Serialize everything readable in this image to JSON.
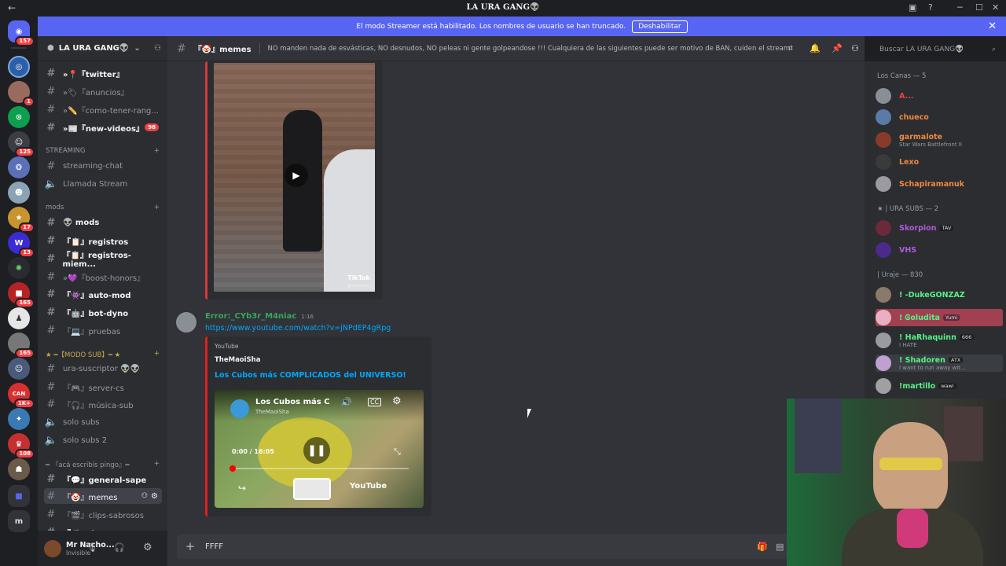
{
  "window": {
    "title": "LA URA GANG👽",
    "back_icon": "←"
  },
  "banner": {
    "message": "El modo Streamer está habilitado. Los nombres de usuario se han truncado.",
    "button_label": "Deshabilitar",
    "bg_color": "#5865f2"
  },
  "guilds": {
    "home_badge": "157",
    "badges": [
      "1",
      "125",
      "17",
      "13",
      "165",
      "165",
      "1K+",
      "108"
    ]
  },
  "server": {
    "name": "LA URA GANG👽"
  },
  "sidebar": {
    "channels_top": [
      {
        "label": "»📍『twitter』",
        "state": "unread"
      },
      {
        "label": "»🏷『anuncios』",
        "state": "muted"
      },
      {
        "label": "»✏️『como-tener-rang...",
        "state": "muted"
      },
      {
        "label": "»📰『new-videos』",
        "state": "unread",
        "badge": "98"
      }
    ],
    "categories": {
      "streaming": "STREAMING",
      "mods": "mods",
      "modo_sub": "★ ═【MODO SUB】═ ★",
      "aca": "═ 『acá escribís pingo』═"
    },
    "streaming_channels": [
      {
        "label": "streaming-chat",
        "type": "text"
      },
      {
        "label": "Llamada Stream",
        "type": "voice"
      }
    ],
    "mods_channels": [
      {
        "label": "👽 mods",
        "state": "unread"
      },
      {
        "label": "『📋』registros",
        "state": "unread"
      },
      {
        "label": "『📋』registros-miem...",
        "state": "unread"
      },
      {
        "label": "»💜『boost-honors』",
        "state": "muted"
      },
      {
        "label": "『👾』auto-mod",
        "state": "unread"
      },
      {
        "label": "『🤖』bot-dyno",
        "state": "unread"
      },
      {
        "label": "『💻』pruebas",
        "state": "muted"
      }
    ],
    "sub_channels": [
      {
        "label": "ura-suscriptor 👽👽",
        "type": "text"
      },
      {
        "label": "『🎮』server-cs",
        "type": "text"
      },
      {
        "label": "『🎧』música-sub",
        "type": "text"
      },
      {
        "label": "solo subs",
        "type": "voice"
      },
      {
        "label": "solo subs 2",
        "type": "voice"
      }
    ],
    "aca_channels": [
      {
        "label": "『💬』general-sape",
        "state": "unread"
      },
      {
        "label": "『🤡』memes",
        "state": "active"
      },
      {
        "label": "『🎬』clips-sabrosos",
        "state": "muted"
      },
      {
        "label": "『🎵』down-rap",
        "state": "unread"
      }
    ]
  },
  "user": {
    "name": "Mr Nacho...",
    "status": "Invisible"
  },
  "channel": {
    "name": "『🤡』memes",
    "topic": "NO manden nada de esvásticas, NO desnudos, NO peleas ni gente golpeandose !!! Cualquiera de las siguientes puede ser motivo de BAN, cuiden el stream!",
    "search_placeholder": "Buscar LA URA GANG👽"
  },
  "messages": {
    "tiktok_label": "TikTok",
    "tiktok_handle": "@elkabitobi",
    "author": "Error:_CYb3r_M4niac",
    "time": "1:16",
    "link": "https://www.youtube.com/watch?v=jNPdEP4gRpg",
    "embed_provider": "YouTube",
    "embed_author": "TheMaoiSha",
    "embed_title": "Los Cubos más COMPLICADOS del UNIVERSO!",
    "video_title": "Los Cubos más C",
    "video_channel": "TheMaoiSha",
    "video_time": "0:00 / 16:05",
    "video_brand": "YouTube",
    "progress_fraction": 0.0
  },
  "composer": {
    "text": "FFFF"
  },
  "member_groups": [
    {
      "title": "Los Canas — 5",
      "members": [
        {
          "name": "A...",
          "sub": "",
          "color": "#f23f43"
        },
        {
          "name": "chueco",
          "sub": "",
          "color": "#f0883e"
        },
        {
          "name": "garmalote",
          "sub": "Star Wars Battlefront II",
          "color": "#f0883e"
        },
        {
          "name": "Lexo",
          "sub": "",
          "color": "#f0883e"
        },
        {
          "name": "Schapiramanuk",
          "sub": "",
          "color": "#f0883e"
        }
      ]
    },
    {
      "title": "★ | URA SUBS — 2",
      "members": [
        {
          "name": "Skorpion",
          "sub": "",
          "color": "#b05ad8",
          "tag": "TAV"
        },
        {
          "name": "VHS",
          "sub": "",
          "color": "#b05ad8"
        }
      ]
    },
    {
      "title": "| Uraje — 830",
      "members": [
        {
          "name": "! -DukeGONZAZ",
          "sub": "",
          "color": "#57f287"
        },
        {
          "name": "! Ꮆoludita",
          "sub": "",
          "color": "#57f287",
          "tag": "Yumi"
        },
        {
          "name": "! HaRhaquinn",
          "sub": "I HATE",
          "color": "#57f287",
          "tag": "666"
        },
        {
          "name": "! Shadoren",
          "sub": "I want to run away wit...",
          "color": "#57f287",
          "tag": "ATX"
        },
        {
          "name": "!martillo",
          "sub": "",
          "color": "#57f287",
          "tag": "wawi"
        }
      ]
    }
  ]
}
